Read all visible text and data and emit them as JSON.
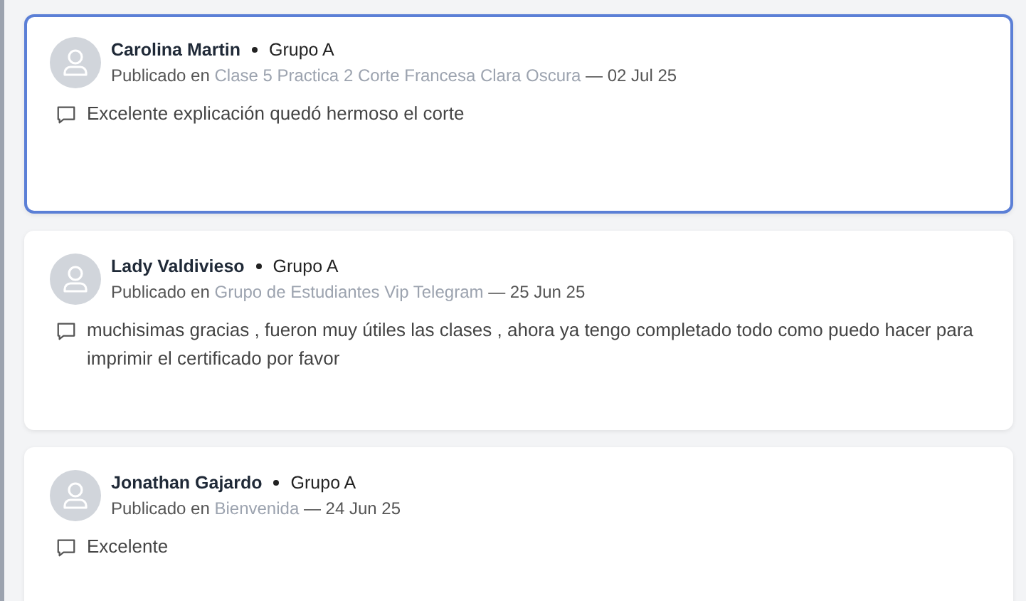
{
  "posts": [
    {
      "author": "Carolina Martin",
      "group": "Grupo A",
      "posted_in_label": "Publicado en",
      "topic": "Clase 5 Practica 2 Corte Francesa Clara Oscura",
      "date": "— 02 Jul 25",
      "comment": "Excelente explicación quedó hermoso el corte",
      "selected": true
    },
    {
      "author": "Lady Valdivieso",
      "group": "Grupo A",
      "posted_in_label": "Publicado en",
      "topic": "Grupo de Estudiantes Vip Telegram",
      "date": "— 25 Jun 25",
      "comment": "muchisimas gracias , fueron muy útiles las clases , ahora ya tengo completado todo como puedo hacer para imprimir el certificado por favor",
      "selected": false
    },
    {
      "author": "Jonathan Gajardo",
      "group": "Grupo A",
      "posted_in_label": "Publicado en",
      "topic": "Bienvenida",
      "date": "— 24 Jun 25",
      "comment": "Excelente",
      "selected": false
    }
  ]
}
